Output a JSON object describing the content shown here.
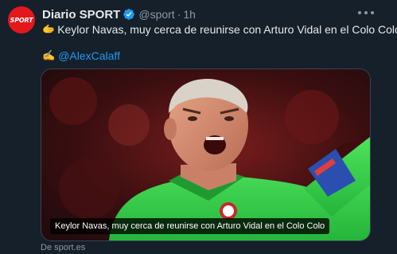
{
  "tweet": {
    "author_name": "Diario SPORT",
    "handle": "@sport",
    "separator": "·",
    "time": "1h",
    "avatar_text": "SPORT",
    "line1_emoji": "🫱",
    "line1_text": "Keylor Navas, muy cerca de reunirse con Arturo Vidal en el Colo Colo",
    "line2_emoji": "✍️",
    "mention": "@AlexCalaff",
    "media": {
      "caption": "Keylor Navas, muy cerca de reunirse con Arturo Vidal en el Colo Colo",
      "source": "De sport.es"
    }
  },
  "colors": {
    "background": "#15202b",
    "text": "#e7e9ea",
    "secondary": "#8b98a5",
    "link": "#1d9bf0",
    "brand_red": "#e4181c",
    "jersey": "#39d94a"
  },
  "icons": {
    "verified": "verified-badge-icon",
    "more": "more-horizontal-icon"
  }
}
